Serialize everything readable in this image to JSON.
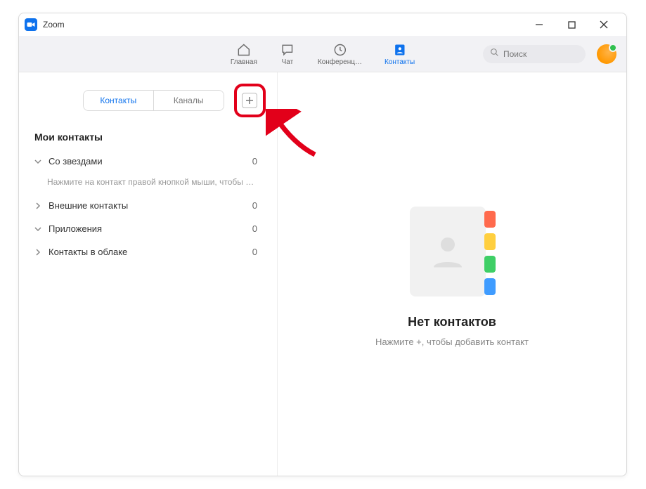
{
  "titlebar": {
    "title": "Zoom"
  },
  "nav": {
    "home": "Главная",
    "chat": "Чат",
    "meetings": "Конференц…",
    "contacts": "Контакты"
  },
  "search": {
    "placeholder": "Поиск"
  },
  "tabs": {
    "contacts": "Контакты",
    "channels": "Каналы"
  },
  "section": {
    "my_contacts": "Мои контакты"
  },
  "groups": {
    "starred": {
      "label": "Со звездами",
      "count": "0",
      "hint": "Нажмите на контакт правой кнопкой мыши, чтобы …"
    },
    "external": {
      "label": "Внешние контакты",
      "count": "0"
    },
    "apps": {
      "label": "Приложения",
      "count": "0"
    },
    "cloud": {
      "label": "Контакты в облаке",
      "count": "0"
    }
  },
  "empty": {
    "title": "Нет контактов",
    "subtitle": "Нажмите +, чтобы добавить контакт"
  },
  "colors": {
    "tab1": "#ff6a4d",
    "tab2": "#ffcf3f",
    "tab3": "#3fcf66",
    "tab4": "#3f9cff"
  }
}
